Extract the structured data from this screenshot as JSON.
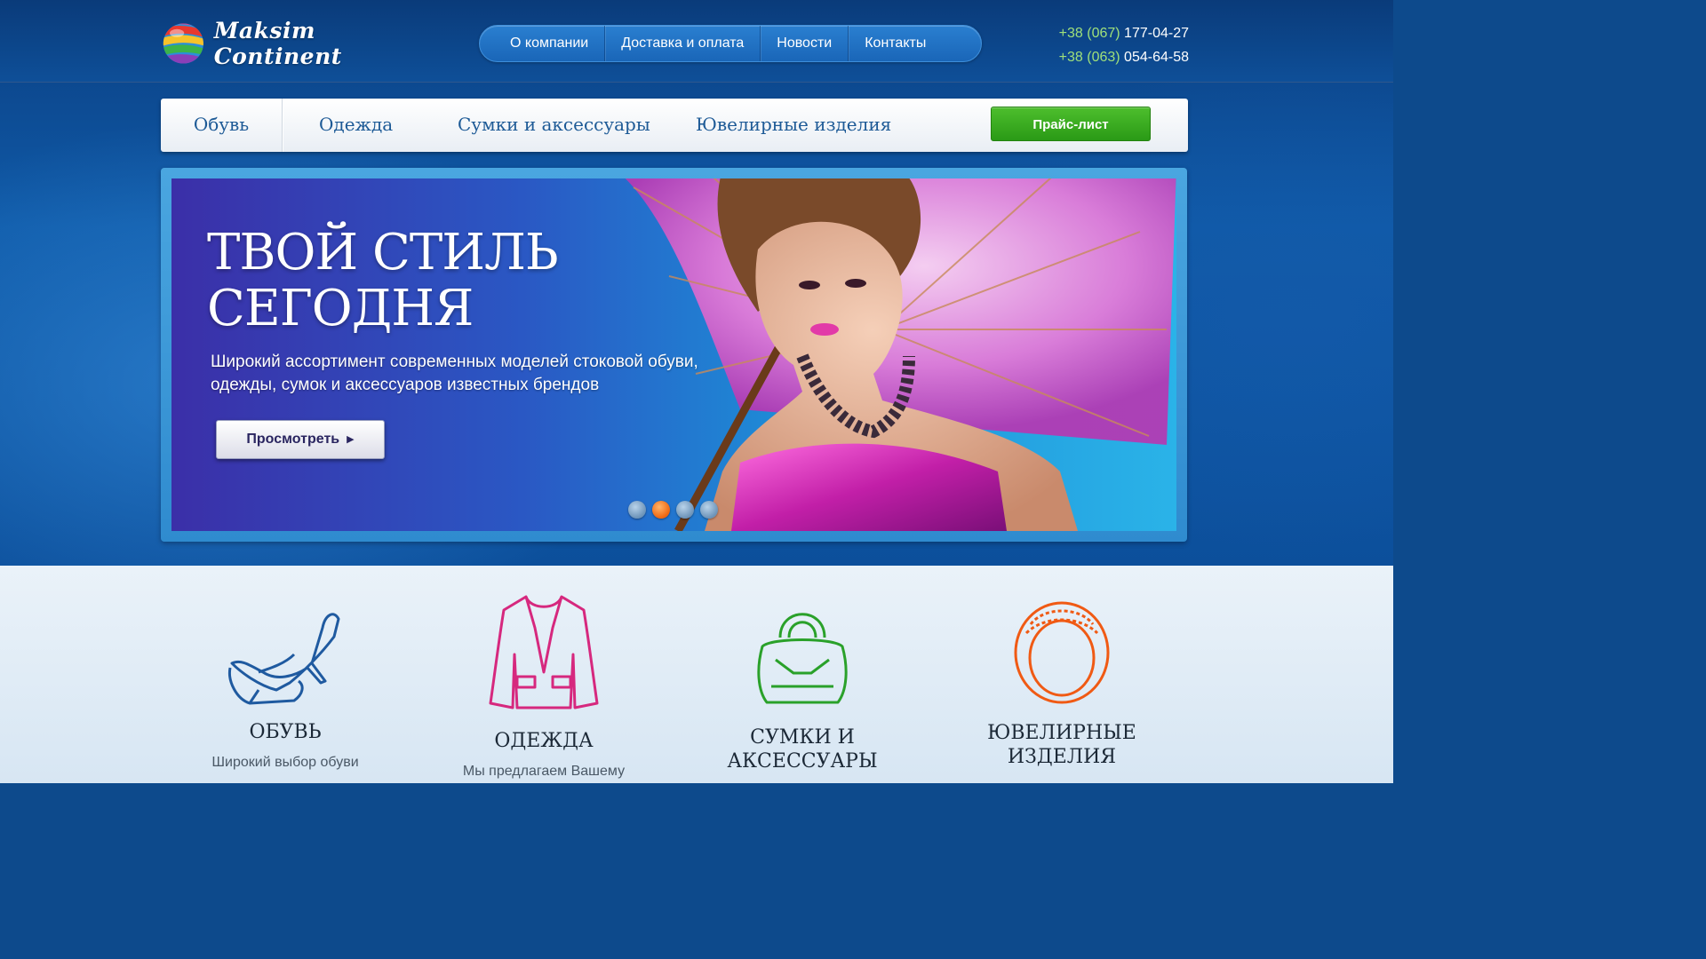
{
  "brand": {
    "name": "Maksim Continent"
  },
  "top_nav": [
    {
      "label": "О компании"
    },
    {
      "label": "Доставка и оплата"
    },
    {
      "label": "Новости"
    },
    {
      "label": "Контакты"
    }
  ],
  "phones": [
    {
      "code": "+38 (067)",
      "number": "177-04-27"
    },
    {
      "code": "+38 (063)",
      "number": "054-64-58"
    }
  ],
  "categories": [
    {
      "label": "Обувь"
    },
    {
      "label": "Одежда"
    },
    {
      "label": "Сумки и аксессуары"
    },
    {
      "label": "Ювелирные изделия"
    }
  ],
  "price_button": {
    "label": "Прайс-лист"
  },
  "slider": {
    "title_line1": "Твой стиль",
    "title_line2": "сегодня",
    "description": "Широкий ассортимент современных моделей стоковой обуви, одежды, сумок и аксессуаров известных брендов",
    "button_label": "Просмотреть",
    "slide_count": 4,
    "active_slide": 2
  },
  "features": [
    {
      "title": "Обувь",
      "text": "Широкий выбор обуви",
      "icon": "shoe-icon",
      "color": "#1f5aa0"
    },
    {
      "title": "Одежда",
      "text": "Мы предлагаем Вашему",
      "icon": "jacket-icon",
      "color": "#d6287e"
    },
    {
      "title": "Сумки и аксессуары",
      "text": "",
      "icon": "handbag-icon",
      "color": "#2aa12a"
    },
    {
      "title": "Ювелирные изделия",
      "text": "",
      "icon": "ring-icon",
      "color": "#f05a14"
    }
  ],
  "colors": {
    "accent_green": "#9fe07a",
    "button_green": "#2a9a16",
    "active_dot": "#f0650e"
  }
}
